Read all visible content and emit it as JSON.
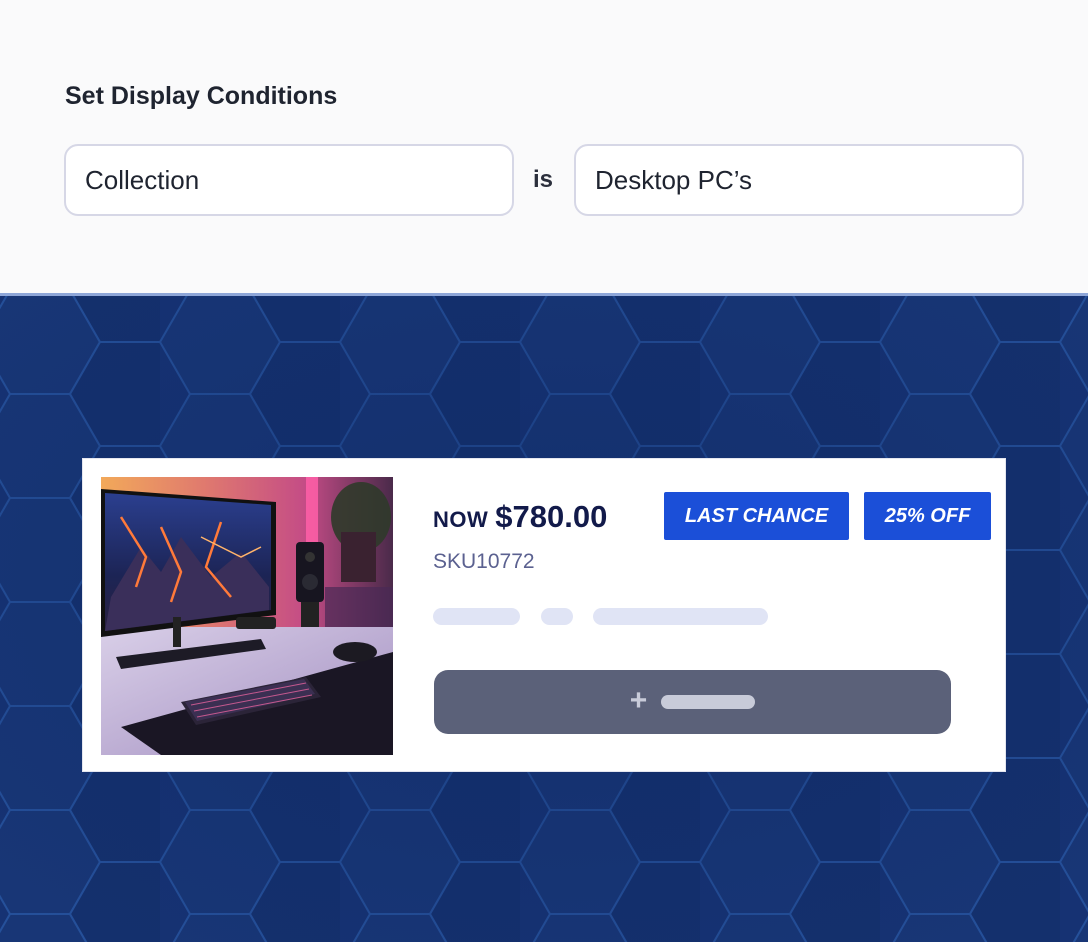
{
  "conditions": {
    "heading": "Set Display Conditions",
    "field_value": "Collection",
    "operator": "is",
    "target_value": "Desktop PC’s"
  },
  "product_card": {
    "now_label": "NOW",
    "price": "$780.00",
    "sku": "SKU10772",
    "badges": [
      "LAST CHANCE",
      "25% OFF"
    ],
    "image_icon": "desktop-pc-setup-photo"
  },
  "colors": {
    "background_top": "#fafafb",
    "background_bottom": "#163273",
    "badge": "#1b4fd8",
    "price_text": "#121a4a",
    "button": "#5b6179"
  }
}
